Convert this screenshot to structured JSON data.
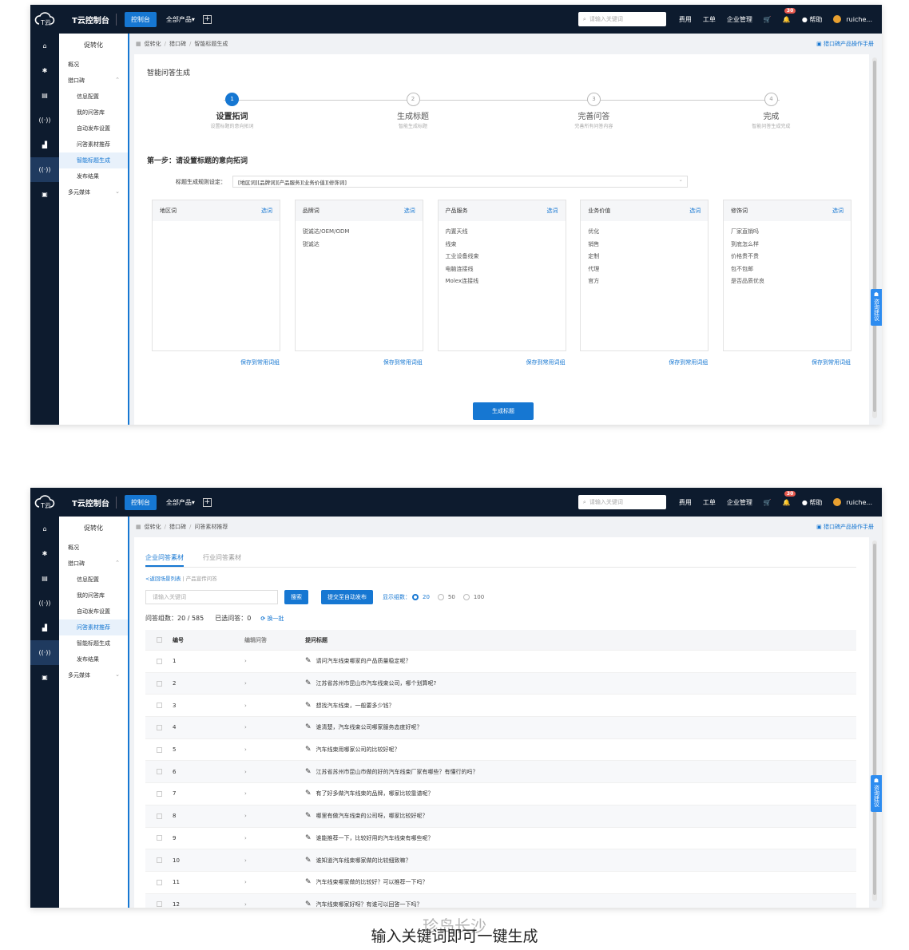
{
  "topbar": {
    "brand": "T云控制台",
    "console_btn": "控制台",
    "all_products": "全部产品▾",
    "plus": "+",
    "search_placeholder": "请输入关键词",
    "fee": "费用",
    "ticket": "工单",
    "enterprise": "企业管理",
    "badge": "30",
    "help": "帮助",
    "user": "ruiche..."
  },
  "sidebar": {
    "title": "促转化",
    "overview": "概况",
    "group": "猎口碑",
    "items": [
      "信息配置",
      "我的问答库",
      "自动发布设置",
      "问答素材推荐",
      "智能标题生成",
      "发布结果"
    ],
    "multi": "多元媒体"
  },
  "feedback": "咨询建议",
  "shot1": {
    "breadcrumb": [
      "促转化",
      "猎口碑",
      "智能标题生成"
    ],
    "manual": "猎口碑产品操作手册",
    "page_title": "智能问答生成",
    "steps": [
      {
        "num": "1",
        "title": "设置拓词",
        "desc": "设置标题的意向拓词"
      },
      {
        "num": "2",
        "title": "生成标题",
        "desc": "智能生成标题"
      },
      {
        "num": "3",
        "title": "完善问答",
        "desc": "完善所有问答内容"
      },
      {
        "num": "4",
        "title": "完成",
        "desc": "智能问答生成完成"
      }
    ],
    "subhead": "第一步：请设置标题的意向拓词",
    "rule_label": "标题生成规则设定：",
    "rule_value": "[地区词][品牌词][产品服务][业务价值][修饰词]",
    "select_label": "选词",
    "save_label": "保存到常用词组",
    "cards": [
      {
        "title": "地区词",
        "words": []
      },
      {
        "title": "品牌词",
        "words": [
          "锐诚达/OEM/ODM",
          "锐诚达"
        ]
      },
      {
        "title": "产品服务",
        "words": [
          "内置天线",
          "线束",
          "工业设备线束",
          "电脑连接线",
          "Molex连接线"
        ]
      },
      {
        "title": "业务价值",
        "words": [
          "优化",
          "销售",
          "定制",
          "代理",
          "官方"
        ]
      },
      {
        "title": "修饰词",
        "words": [
          "厂家直销吗",
          "到底怎么样",
          "价格贵不贵",
          "包不包邮",
          "是否品质优良"
        ]
      }
    ],
    "gen_button": "生成标题"
  },
  "shot2": {
    "breadcrumb": [
      "促转化",
      "猎口碑",
      "问答素材推荐"
    ],
    "manual": "猎口碑产品操作手册",
    "tabs": [
      "企业问答素材",
      "行业问答素材"
    ],
    "back_link": "<返回场景列表",
    "back_sub": "产品宣传问答",
    "search_placeholder": "请输入关键词",
    "search_btn": "搜索",
    "submit_btn": "提交至自动发布",
    "show_label": "显示组数：",
    "page_sizes": [
      "20",
      "50",
      "100"
    ],
    "stats_total": "问答组数：20 / 585",
    "stats_selected": "已选问答：0",
    "refresh": "换一批",
    "headers": [
      "编号",
      "编辑问答",
      "提问标题"
    ],
    "rows": [
      {
        "no": "1",
        "q": "请问汽车线束哪家的产品质量稳定呢？"
      },
      {
        "no": "2",
        "q": "江苏省苏州市昆山市汽车线束公司，哪个划算呢?"
      },
      {
        "no": "3",
        "q": "想找汽车线束，一般要多少钱？"
      },
      {
        "no": "4",
        "q": "谁清楚，汽车线束公司哪家服务态度好呢？"
      },
      {
        "no": "5",
        "q": "汽车线束用哪家公司的比较好呢？"
      },
      {
        "no": "6",
        "q": "江苏省苏州市昆山市做的好的汽车线束厂家有哪些？有懂行的吗？"
      },
      {
        "no": "7",
        "q": "有了好多做汽车线束的品牌，哪家比较靠谱呢？"
      },
      {
        "no": "8",
        "q": "哪里有做汽车线束的公司呀，哪家比较好呢？"
      },
      {
        "no": "9",
        "q": "谁能推荐一下，比较好用的汽车线束有哪些呢？"
      },
      {
        "no": "10",
        "q": "谁知道汽车线束哪家做的比较细致嘛？"
      },
      {
        "no": "11",
        "q": "汽车线束哪家做的比较好？可以推荐一下吗？"
      },
      {
        "no": "12",
        "q": "汽车线束哪家好呀？有谁可以回答一下吗？"
      }
    ]
  },
  "watermark": "珍岛长沙",
  "caption": "输入关键词即可一键生成"
}
